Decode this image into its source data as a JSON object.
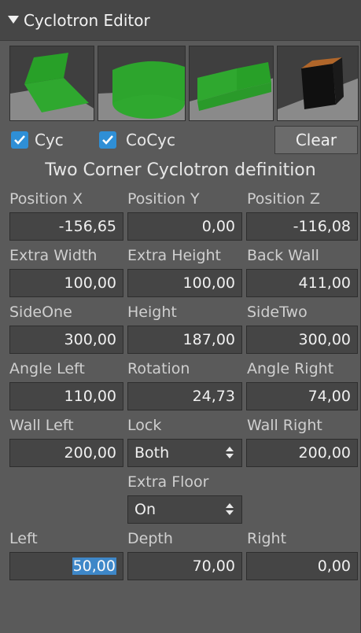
{
  "window": {
    "title": "Cyclotron Editor"
  },
  "presets": [
    {
      "icon": "single-wall-cyc-preset-icon"
    },
    {
      "icon": "curved-cyc-preset-icon"
    },
    {
      "icon": "two-corner-cyc-preset-icon"
    },
    {
      "icon": "block-object-preset-icon"
    }
  ],
  "options": {
    "cyc_label": "Cyc",
    "cyc_checked": true,
    "cocyc_label": "CoCyc",
    "cocyc_checked": true,
    "clear_label": "Clear"
  },
  "definition_title": "Two Corner Cyclotron definition",
  "rows": [
    {
      "labels": [
        "Position X",
        "Position Y",
        "Position Z"
      ],
      "values": [
        "-156,65",
        "0,00",
        "-116,08"
      ]
    },
    {
      "labels": [
        "Extra Width",
        "Extra Height",
        "Back Wall"
      ],
      "values": [
        "100,00",
        "100,00",
        "411,00"
      ]
    },
    {
      "labels": [
        "SideOne",
        "Height",
        "SideTwo"
      ],
      "values": [
        "300,00",
        "187,00",
        "300,00"
      ]
    },
    {
      "labels": [
        "Angle Left",
        "Rotation",
        "Angle Right"
      ],
      "values": [
        "110,00",
        "24,73",
        "74,00"
      ]
    },
    {
      "labels": [
        "Wall Left",
        "Lock",
        "Wall Right"
      ],
      "values": [
        "200,00",
        "Both",
        "200,00"
      ]
    }
  ],
  "extra_floor": {
    "label": "Extra Floor",
    "value": "On"
  },
  "depth_row": {
    "labels": [
      "Left",
      "Depth",
      "Right"
    ],
    "values": [
      "50,00",
      "70,00",
      "0,00"
    ]
  },
  "colors": {
    "accent": "#3e87c8",
    "checkbox": "#2f8fd6",
    "preset_green": "#2fa82f"
  }
}
